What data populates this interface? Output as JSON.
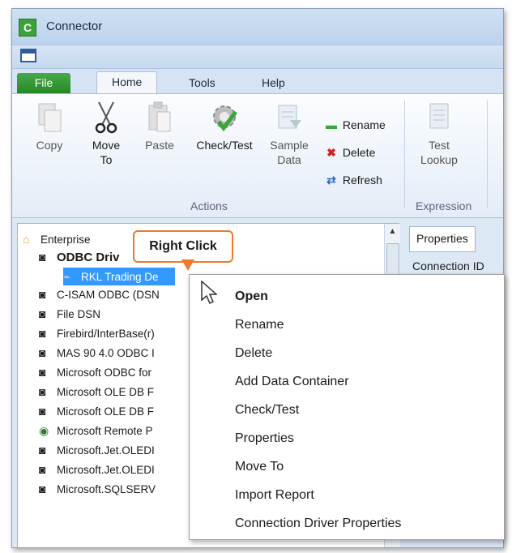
{
  "window": {
    "title": "Connector",
    "app_icon": "C"
  },
  "ribbon_tabs": [
    "File",
    "Home",
    "Tools",
    "Help"
  ],
  "actions": {
    "copy": "Copy",
    "move_to_line1": "Move",
    "move_to_line2": "To",
    "paste": "Paste",
    "check_test": "Check/Test",
    "sample_line1": "Sample",
    "sample_line2": "Data",
    "rename": "Rename",
    "delete": "Delete",
    "refresh": "Refresh",
    "group_label": "Actions"
  },
  "expression": {
    "test_line1": "Test",
    "test_line2": "Lookup",
    "group_label": "Expression"
  },
  "tree": {
    "root": "Enterprise",
    "items": [
      "ODBC Driv",
      "RKL Trading De",
      "C-ISAM ODBC (DSN",
      "File DSN",
      "Firebird/InterBase(r)",
      "MAS 90 4.0 ODBC I",
      "Microsoft ODBC for",
      "Microsoft OLE DB F",
      "Microsoft OLE DB F",
      "Microsoft Remote P",
      "Microsoft.Jet.OLEDI",
      "Microsoft.Jet.OLEDI",
      "Microsoft.SQLSERV"
    ]
  },
  "properties": {
    "tab": "Properties",
    "first_row": "Connection ID"
  },
  "callout": "Right Click",
  "context_menu": [
    "Open",
    "Rename",
    "Delete",
    "Add Data Container",
    "Check/Test",
    "Properties",
    "Move To",
    "Import Report",
    "Connection Driver Properties"
  ],
  "colors": {
    "file_tab": "#2e962e",
    "callout_border": "#f07a2a",
    "selection": "#3399ff"
  }
}
